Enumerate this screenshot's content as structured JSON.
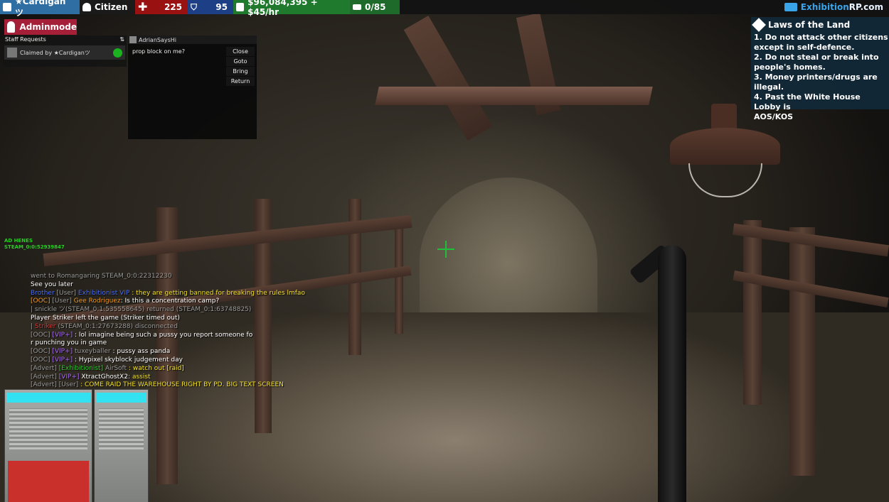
{
  "hud": {
    "player_name": "★Cardiganツ",
    "job": "Citizen",
    "health": "225",
    "armor": "95",
    "money": "$96,084,395 + $45/hr",
    "props": "0/85",
    "brand_accent": "Exhibition",
    "brand_rest": "RP.com",
    "colors": {
      "name_bar": "#2f6ea2",
      "health_bar": "#9a1111",
      "armor_bar": "#1c3f86",
      "money_bar": "#1f7a2d"
    }
  },
  "adminmode": {
    "label": "Adminmode",
    "icon": "key-icon",
    "color": "#a61f38"
  },
  "staff_requests": {
    "title": "Staff Requests",
    "row_text": "Claimed by ★Cardiganツ",
    "status_color": "#1ab21e"
  },
  "request_popup": {
    "player": "AdrianSaysHi",
    "message": "prop block on me?",
    "buttons": [
      "Close",
      "Goto",
      "Bring",
      "Return"
    ]
  },
  "laws": {
    "title": "Laws of the Land",
    "lines": [
      "1. Do not attack other citizens",
      "except in self-defence.",
      "2. Do not steal or break into",
      "people's homes.",
      "3. Money printers/drugs are illegal.",
      "4. Past the White House Lobby is",
      "AOS/KOS"
    ]
  },
  "overlay": {
    "line1": "AD HENES",
    "line2": "STEAM_0:0:52939847"
  },
  "chat": [
    {
      "parts": [
        {
          "c": "c-grey",
          "t": "went to Romangaring STEAM_0:0:22312230"
        }
      ]
    },
    {
      "parts": [
        {
          "c": "c-white",
          "t": "See you later"
        }
      ]
    },
    {
      "parts": [
        {
          "c": "c-blue",
          "t": "Brother"
        },
        {
          "c": "c-grey",
          "t": " [User] "
        },
        {
          "c": "c-blue",
          "t": "Exhibitionist VIP "
        },
        {
          "c": "c-yellow",
          "t": ": they are getting banned for breaking the rules lmfao"
        }
      ]
    },
    {
      "parts": [
        {
          "c": "c-orange",
          "t": "[OOC] "
        },
        {
          "c": "c-grey",
          "t": "[User] "
        },
        {
          "c": "c-orange",
          "t": "Gee Rodriguez"
        },
        {
          "c": "c-white",
          "t": ": Is this a concentration camp?"
        }
      ]
    },
    {
      "parts": [
        {
          "c": "c-grey",
          "t": "| snickle ツ(STEAM_0:1:535558645) returned "
        },
        {
          "c": "c-grey",
          "t": "(STEAM_0:1:63748825)"
        }
      ]
    },
    {
      "parts": [
        {
          "c": "c-white",
          "t": "Player Striker left the game (Striker timed out)"
        }
      ]
    },
    {
      "parts": [
        {
          "c": "c-grey",
          "t": "| "
        },
        {
          "c": "c-red",
          "t": "Striker"
        },
        {
          "c": "c-grey",
          "t": " (STEAM_0:1:27673288) disconnected"
        }
      ]
    },
    {
      "parts": [
        {
          "c": "c-grey",
          "t": "[OOC] "
        },
        {
          "c": "c-purple",
          "t": "[VIP+]"
        },
        {
          "c": "c-grey",
          "t": " "
        },
        {
          "c": "c-white",
          "t": ": lol imagine being such a pussy you report someone fo"
        }
      ]
    },
    {
      "parts": [
        {
          "c": "c-white",
          "t": "r punching you in game"
        }
      ]
    },
    {
      "parts": [
        {
          "c": "c-grey",
          "t": "[OOC] "
        },
        {
          "c": "c-purple",
          "t": "[VIP+]"
        },
        {
          "c": "c-grey",
          "t": " tuxeyballer "
        },
        {
          "c": "c-white",
          "t": ": pussy ass panda"
        }
      ]
    },
    {
      "parts": [
        {
          "c": "c-grey",
          "t": "[OOC] "
        },
        {
          "c": "c-purple",
          "t": "[VIP+]"
        },
        {
          "c": "c-grey",
          "t": " "
        },
        {
          "c": "c-white",
          "t": ": Hypixel skyblock judgement day"
        }
      ]
    },
    {
      "parts": [
        {
          "c": "c-grey",
          "t": "[Advert] "
        },
        {
          "c": "c-green",
          "t": "[Exhibitionist]"
        },
        {
          "c": "c-grey",
          "t": " AirSoft "
        },
        {
          "c": "c-yellow",
          "t": ": watch out [raid]"
        }
      ]
    },
    {
      "parts": [
        {
          "c": "c-grey",
          "t": "[Advert] "
        },
        {
          "c": "c-purple",
          "t": "[VIP+]"
        },
        {
          "c": "c-white",
          "t": " XtractGhostX2"
        },
        {
          "c": "c-yellow",
          "t": ": assist"
        }
      ]
    },
    {
      "parts": [
        {
          "c": "c-grey",
          "t": "[Advert] "
        },
        {
          "c": "c-grey",
          "t": "[User] "
        },
        {
          "c": "c-grey",
          "t": " "
        },
        {
          "c": "c-yellow",
          "t": ": COME RAID THE WAREHOUSE RIGHT BY PD. BIG TEXT SCREEN"
        }
      ]
    }
  ]
}
